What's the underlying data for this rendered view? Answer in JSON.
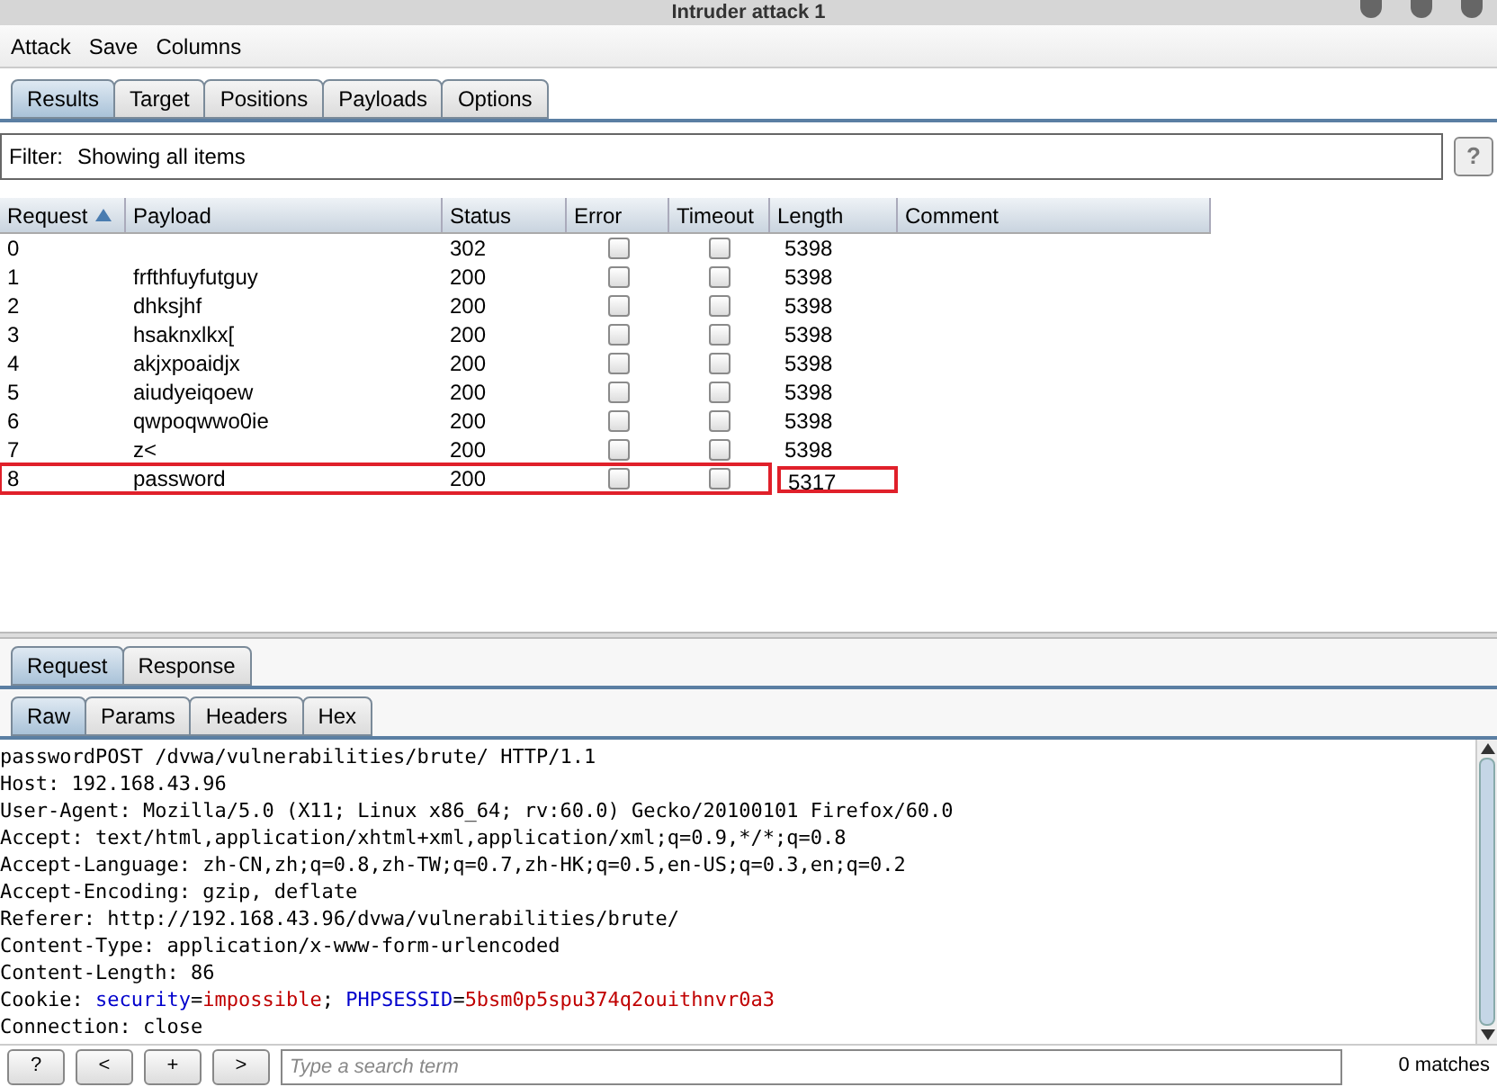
{
  "window": {
    "title": "Intruder attack 1"
  },
  "menu": [
    "Attack",
    "Save",
    "Columns"
  ],
  "tabs": [
    {
      "label": "Results",
      "selected": true
    },
    {
      "label": "Target",
      "selected": false
    },
    {
      "label": "Positions",
      "selected": false
    },
    {
      "label": "Payloads",
      "selected": false
    },
    {
      "label": "Options",
      "selected": false
    }
  ],
  "filter": {
    "label": "Filter:",
    "value": "Showing all items",
    "help": "?"
  },
  "table": {
    "columns": [
      {
        "label": "Request",
        "sorted": true
      },
      {
        "label": "Payload",
        "sorted": false
      },
      {
        "label": "Status",
        "sorted": false
      },
      {
        "label": "Error",
        "sorted": false
      },
      {
        "label": "Timeout",
        "sorted": false
      },
      {
        "label": "Length",
        "sorted": false
      },
      {
        "label": "Comment",
        "sorted": false
      }
    ],
    "rows": [
      {
        "request": "0",
        "payload": "",
        "status": "302",
        "error": false,
        "timeout": false,
        "length": "5398",
        "highlighted": false
      },
      {
        "request": "1",
        "payload": "frfthfuyfutguy",
        "status": "200",
        "error": false,
        "timeout": false,
        "length": "5398",
        "highlighted": false
      },
      {
        "request": "2",
        "payload": "dhksjhf",
        "status": "200",
        "error": false,
        "timeout": false,
        "length": "5398",
        "highlighted": false
      },
      {
        "request": "3",
        "payload": "hsaknxlkx[",
        "status": "200",
        "error": false,
        "timeout": false,
        "length": "5398",
        "highlighted": false
      },
      {
        "request": "4",
        "payload": "akjxpoaidjx",
        "status": "200",
        "error": false,
        "timeout": false,
        "length": "5398",
        "highlighted": false
      },
      {
        "request": "5",
        "payload": "aiudyeiqoew",
        "status": "200",
        "error": false,
        "timeout": false,
        "length": "5398",
        "highlighted": false
      },
      {
        "request": "6",
        "payload": "qwpoqwwo0ie",
        "status": "200",
        "error": false,
        "timeout": false,
        "length": "5398",
        "highlighted": false
      },
      {
        "request": "7",
        "payload": "z<",
        "status": "200",
        "error": false,
        "timeout": false,
        "length": "5398",
        "highlighted": false
      },
      {
        "request": "8",
        "payload": "password",
        "status": "200",
        "error": false,
        "timeout": false,
        "length": "5317",
        "highlighted": true
      }
    ]
  },
  "message_tabs": [
    {
      "label": "Request",
      "selected": true
    },
    {
      "label": "Response",
      "selected": false
    }
  ],
  "view_tabs": [
    {
      "label": "Raw",
      "selected": true
    },
    {
      "label": "Params",
      "selected": false
    },
    {
      "label": "Headers",
      "selected": false
    },
    {
      "label": "Hex",
      "selected": false
    }
  ],
  "raw_lines": [
    [
      {
        "text": "passwordPOST /dvwa/vulnerabilities/brute/ HTTP/1.1",
        "kind": "plain"
      }
    ],
    [
      {
        "text": "Host: 192.168.43.96",
        "kind": "plain"
      }
    ],
    [
      {
        "text": "User-Agent: Mozilla/5.0 (X11; Linux x86_64; rv:60.0) Gecko/20100101 Firefox/60.0",
        "kind": "plain"
      }
    ],
    [
      {
        "text": "Accept: text/html,application/xhtml+xml,application/xml;q=0.9,*/*;q=0.8",
        "kind": "plain"
      }
    ],
    [
      {
        "text": "Accept-Language: zh-CN,zh;q=0.8,zh-TW;q=0.7,zh-HK;q=0.5,en-US;q=0.3,en;q=0.2",
        "kind": "plain"
      }
    ],
    [
      {
        "text": "Accept-Encoding: gzip, deflate",
        "kind": "plain"
      }
    ],
    [
      {
        "text": "Referer: http://192.168.43.96/dvwa/vulnerabilities/brute/",
        "kind": "plain"
      }
    ],
    [
      {
        "text": "Content-Type: application/x-www-form-urlencoded",
        "kind": "plain"
      }
    ],
    [
      {
        "text": "Content-Length: 86",
        "kind": "plain"
      }
    ],
    [
      {
        "text": "Cookie: ",
        "kind": "plain"
      },
      {
        "text": "security",
        "kind": "key"
      },
      {
        "text": "=",
        "kind": "plain"
      },
      {
        "text": "impossible",
        "kind": "value"
      },
      {
        "text": "; ",
        "kind": "plain"
      },
      {
        "text": "PHPSESSID",
        "kind": "key"
      },
      {
        "text": "=",
        "kind": "plain"
      },
      {
        "text": "5bsm0p5spu374q2ouithnvr0a3",
        "kind": "value"
      }
    ],
    [
      {
        "text": "Connection: close",
        "kind": "plain"
      }
    ]
  ],
  "search": {
    "buttons": [
      "?",
      "<",
      "+",
      ">"
    ],
    "placeholder": "Type a search term",
    "matches": "0 matches"
  }
}
